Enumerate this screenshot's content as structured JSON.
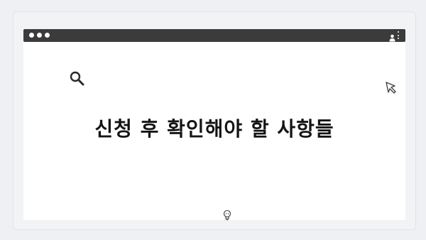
{
  "window": {
    "title_bar": {
      "traffic_lights": [
        "dot",
        "dot",
        "dot"
      ],
      "icons": [
        "user-icon",
        "menu-icon"
      ]
    }
  },
  "content": {
    "heading": "신청 후 확인해야 할 사항들",
    "icons": [
      "search-icon",
      "cursor-icon",
      "idea-icon"
    ]
  },
  "colors": {
    "titlebar": "#3b3b3b",
    "background": "#eef0f3",
    "content": "#ffffff",
    "text": "#141414"
  }
}
